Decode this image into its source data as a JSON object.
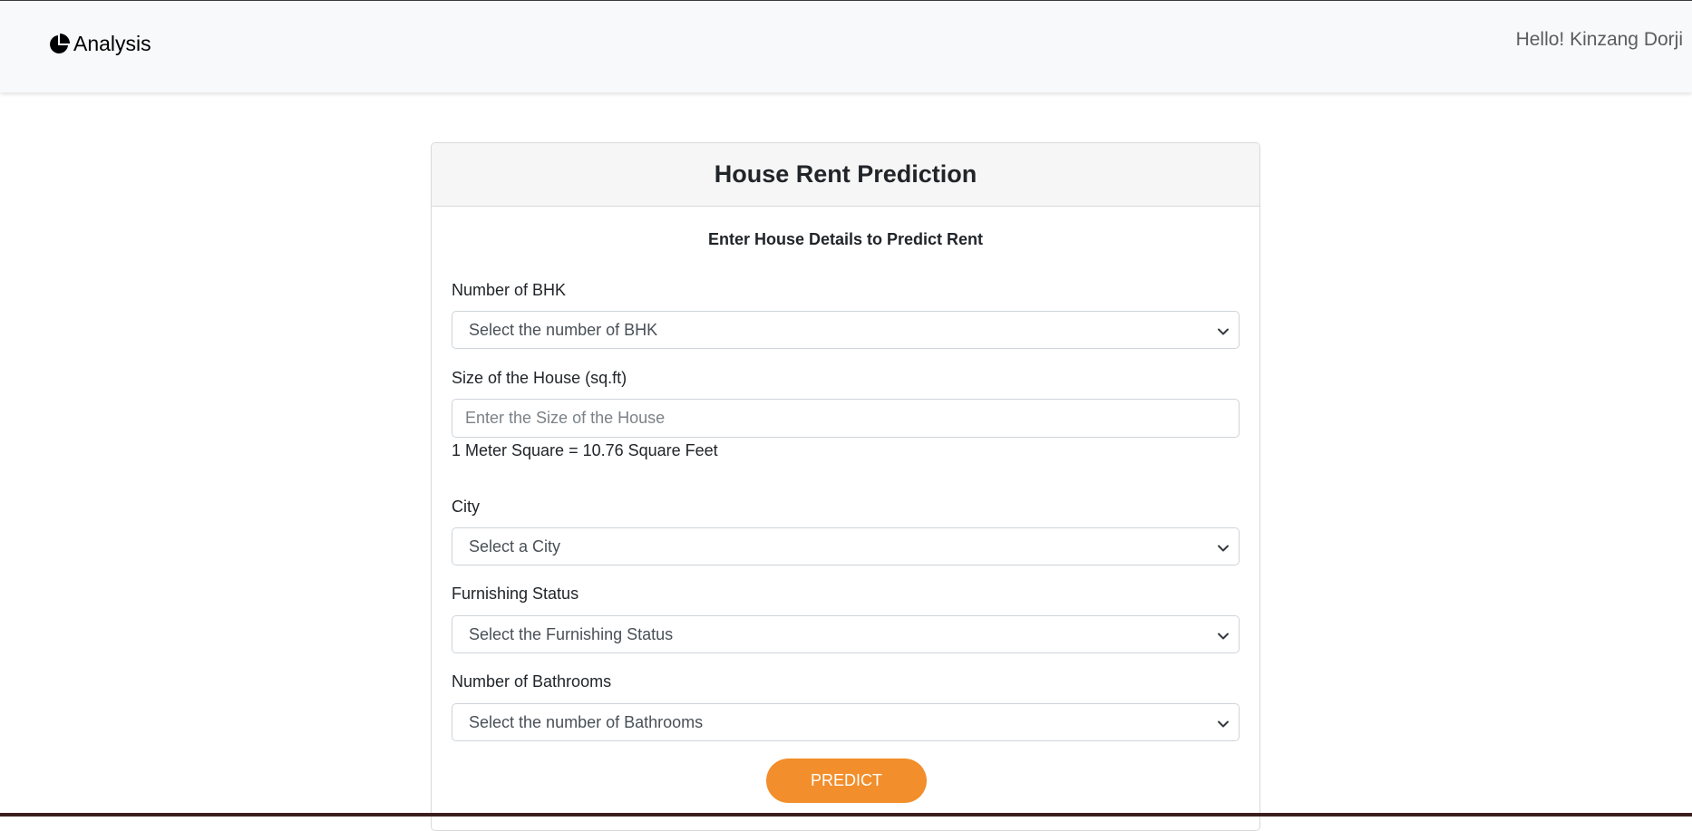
{
  "navbar": {
    "brand_label": "Analysis",
    "greeting": "Hello! Kinzang Dorji"
  },
  "card": {
    "title": "House Rent Prediction",
    "subtitle": "Enter House Details to Predict Rent",
    "fields": {
      "bhk": {
        "label": "Number of BHK",
        "selected": "Select the number of BHK"
      },
      "size": {
        "label": "Size of the House (sq.ft)",
        "value": "",
        "placeholder": "Enter the Size of the House",
        "hint": "1 Meter Square = 10.76 Square Feet"
      },
      "city": {
        "label": "City",
        "selected": "Select a City"
      },
      "furnishing": {
        "label": "Furnishing Status",
        "selected": "Select the Furnishing Status"
      },
      "bathrooms": {
        "label": "Number of Bathrooms",
        "selected": "Select the number of Bathrooms"
      }
    },
    "predict_label": "PREDICT"
  },
  "colors": {
    "accent": "#f28e2b",
    "navbar_bg": "#f8f9fa",
    "card_header_bg": "#f6f6f6"
  },
  "icons": {
    "brand": "pie-chart-icon",
    "select_arrow": "chevron-down-icon"
  }
}
